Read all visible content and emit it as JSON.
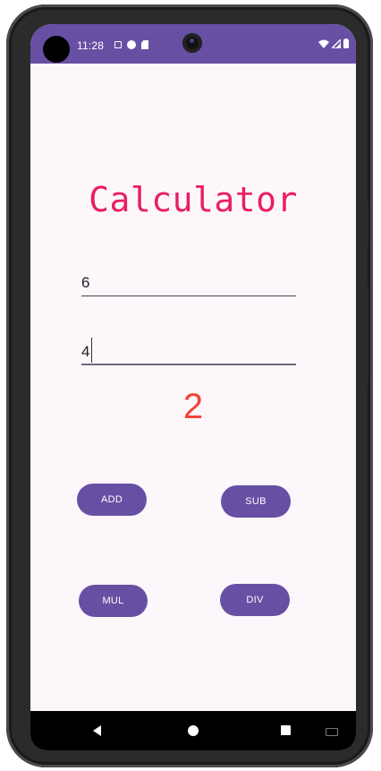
{
  "status_bar": {
    "time": "11:28",
    "color": "#6750a4"
  },
  "app": {
    "title": "Calculator",
    "title_color": "#e91e63",
    "accent": "#6750a4"
  },
  "inputs": {
    "first_value": "6",
    "second_value": "4"
  },
  "result": {
    "value": "2",
    "color": "#f44336"
  },
  "buttons": {
    "add": "ADD",
    "sub": "SUB",
    "mul": "MUL",
    "div": "DIV"
  },
  "nav_bar": {
    "back_icon": "back-triangle",
    "home_icon": "home-circle",
    "recents_icon": "recents-square",
    "keyboard_icon": "keyboard-icon"
  }
}
